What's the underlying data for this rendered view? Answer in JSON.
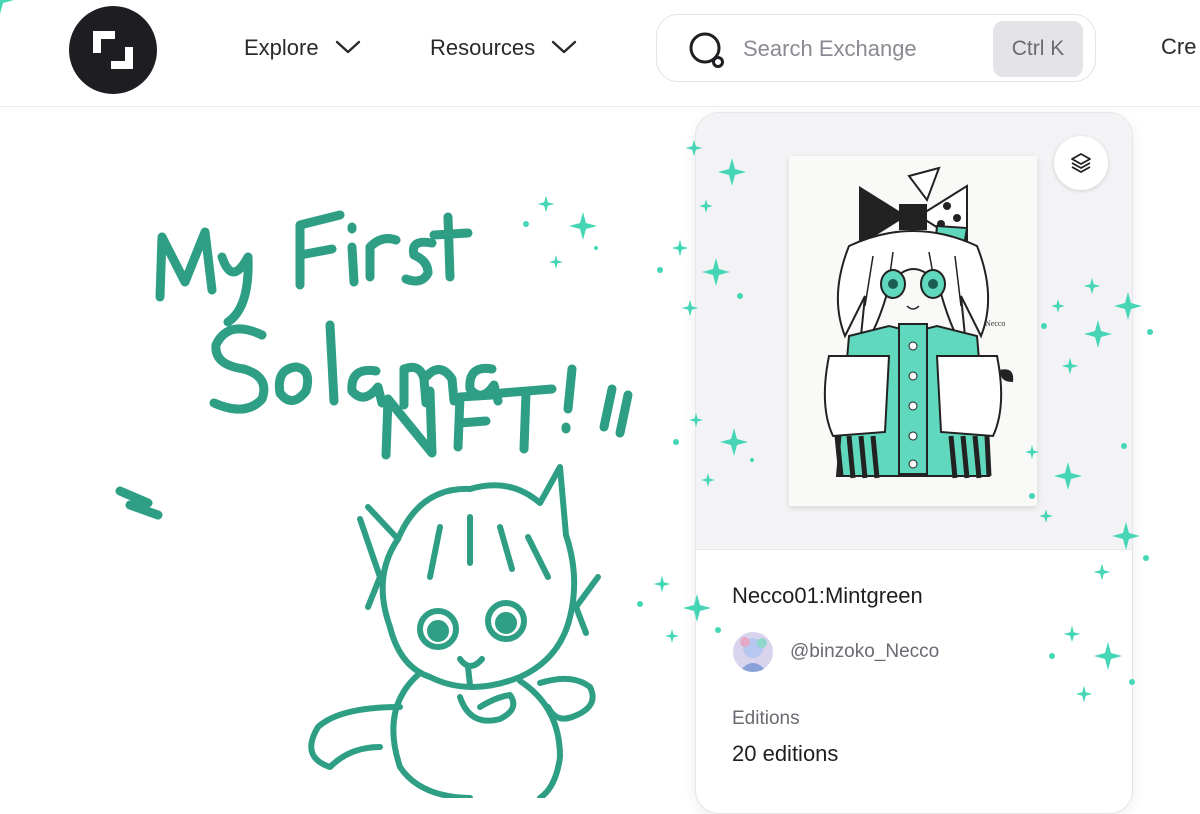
{
  "header": {
    "nav": [
      {
        "label": "Explore",
        "icon": "chevron-down-icon"
      },
      {
        "label": "Resources",
        "icon": "chevron-down-icon"
      }
    ],
    "search": {
      "placeholder": "Search Exchange",
      "shortcut": "Ctrl K",
      "icon": "search-icon"
    },
    "cut_off_action": "Cre"
  },
  "drawing": {
    "lines": [
      "My First",
      "Solama",
      "NFT !"
    ],
    "ink_color": "#2e9e85"
  },
  "card": {
    "title": "Necco01:Mintgreen",
    "creator": "@binzoko_Necco",
    "editions_label": "Editions",
    "editions_value": "20 editions",
    "stack_icon": "layers-icon",
    "accent": "#46d6b6"
  }
}
